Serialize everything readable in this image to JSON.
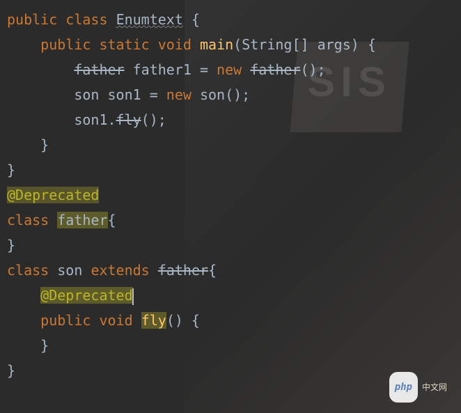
{
  "code": {
    "line1": {
      "public": "public",
      "class": "class",
      "name": "Enumtext",
      "brace": " {"
    },
    "line2": {
      "public": "public",
      "static": "static",
      "void": "void",
      "main": "main",
      "params": "(String[] args) {"
    },
    "line3": {
      "type": "father",
      "var": " father1 = ",
      "new": "new",
      "ctor": "father",
      "end": "();"
    },
    "line4": {
      "type": "son ",
      "var": "son1 = ",
      "new": "new",
      "ctor": " son();"
    },
    "line5": {
      "obj": "son1.",
      "method": "fly",
      "end": "();"
    },
    "line6": {
      "brace": "}"
    },
    "line7": {
      "brace": "}"
    },
    "line8": {
      "annotation": "@Deprecated"
    },
    "line9": {
      "class": "class",
      "name": "father",
      "brace": "{"
    },
    "line10": {
      "brace": "}"
    },
    "line11": {
      "class": "class",
      "name": " son ",
      "extends": "extends",
      "parent": "father",
      "brace": "{"
    },
    "line12": {
      "annotation": "@Deprecated"
    },
    "line13": {
      "public": "public",
      "void": "void",
      "name": "fly",
      "end": "() {"
    },
    "line14": {
      "brace": "}"
    },
    "line15": {
      "brace": "}"
    }
  },
  "watermark": {
    "logo": "php",
    "text": "中文网"
  },
  "bg_text": "SIS"
}
